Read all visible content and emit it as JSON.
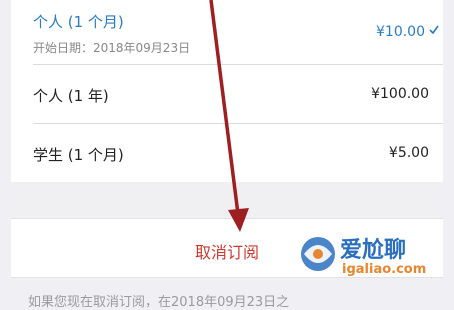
{
  "plans": [
    {
      "name": "个人 (1 个月)",
      "price": "¥10.00",
      "sub": "开始日期：2018年09月23日",
      "selected": true
    },
    {
      "name": "个人 (1 年)",
      "price": "¥100.00"
    },
    {
      "name": "学生 (1 个月)",
      "price": "¥5.00"
    }
  ],
  "cancel_label": "取消订阅",
  "footer_text": "如果您现在取消订阅，在2018年09月23日之",
  "watermark": {
    "brand": "爱尬聊",
    "domain": "igaliao.com"
  },
  "colors": {
    "accent": "#2a7cc7",
    "danger": "#d1372d",
    "arrow": "#9e1f22"
  }
}
